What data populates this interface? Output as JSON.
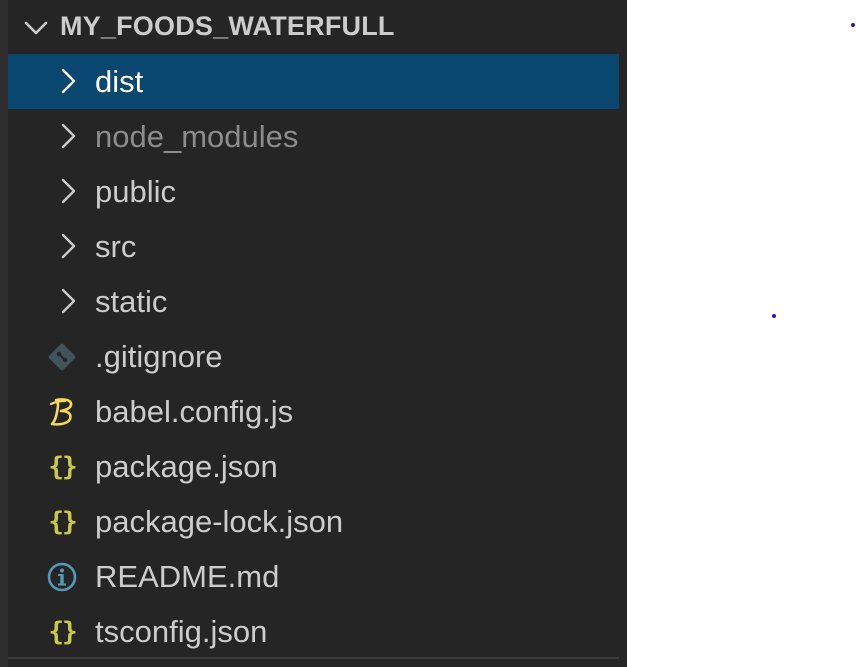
{
  "explorer": {
    "section_title": "MY_FOODS_WATERFULL",
    "items": [
      {
        "label": "dist",
        "kind": "folder",
        "selected": true,
        "icon": "chevron-right-icon"
      },
      {
        "label": "node_modules",
        "kind": "folder",
        "dimmed": true,
        "icon": "chevron-right-icon"
      },
      {
        "label": "public",
        "kind": "folder",
        "icon": "chevron-right-icon"
      },
      {
        "label": "src",
        "kind": "folder",
        "icon": "chevron-right-icon"
      },
      {
        "label": "static",
        "kind": "folder",
        "icon": "chevron-right-icon"
      },
      {
        "label": ".gitignore",
        "kind": "file",
        "icon": "git-icon"
      },
      {
        "label": "babel.config.js",
        "kind": "file",
        "icon": "babel-icon"
      },
      {
        "label": "package.json",
        "kind": "file",
        "icon": "json-braces-icon"
      },
      {
        "label": "package-lock.json",
        "kind": "file",
        "icon": "json-braces-icon"
      },
      {
        "label": "README.md",
        "kind": "file",
        "icon": "info-icon"
      },
      {
        "label": "tsconfig.json",
        "kind": "file",
        "icon": "json-braces-icon"
      }
    ]
  },
  "colors": {
    "background": "#252526",
    "selected_row": "#094771",
    "text": "#cccccc",
    "dimmed_text": "#8c8c8c",
    "json_icon": "#cbcb41",
    "babel_icon": "#f5da55",
    "info_icon": "#519aba",
    "git_icon": "#41535b"
  },
  "icons": {
    "json_glyph": "{}"
  }
}
